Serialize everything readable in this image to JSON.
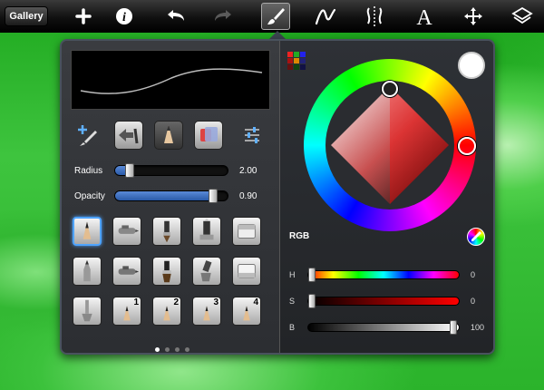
{
  "app": {
    "gallery_label": "Gallery"
  },
  "toolbar": {
    "icons": [
      "add-icon",
      "info-icon",
      "undo-icon",
      "redo-icon",
      "brush-icon",
      "stroke-icon",
      "symmetry-icon",
      "text-icon",
      "transform-icon",
      "layers-icon"
    ],
    "active": "brush-icon"
  },
  "brush_panel": {
    "radius_label": "Radius",
    "radius_value": "2.00",
    "radius_fraction": 0.1,
    "opacity_label": "Opacity",
    "opacity_value": "0.90",
    "opacity_fraction": 0.9,
    "brush_numbers": [
      "1",
      "2",
      "3",
      "4"
    ],
    "page_count": 4,
    "current_page": 1
  },
  "color_panel": {
    "mode_label": "RGB",
    "h_label": "H",
    "h_value": "0",
    "s_label": "S",
    "s_value": "0",
    "b_label": "B",
    "b_value": "100",
    "current_color": "#ffffff",
    "accent": "#4ea3ff"
  }
}
